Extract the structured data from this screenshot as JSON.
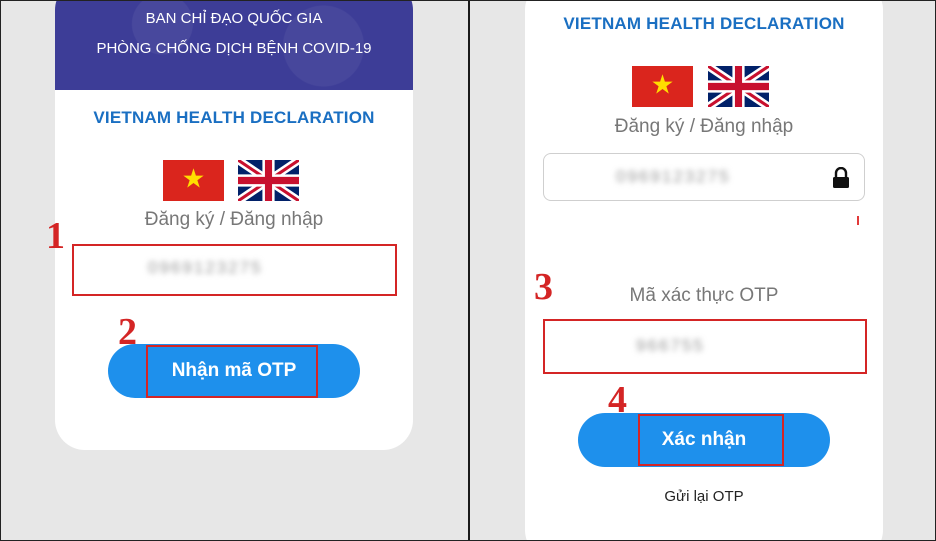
{
  "left_screen": {
    "banner": {
      "line1": "BAN CHỈ ĐẠO QUỐC GIA",
      "line2": "PHÒNG CHỐNG DỊCH BỆNH COVID-19"
    },
    "title": "VIETNAM HEALTH DECLARATION",
    "flags": [
      "vietnam-flag-icon",
      "uk-flag-icon"
    ],
    "login_label": "Đăng ký / Đăng nhập",
    "phone_input_value": "0969123275",
    "get_otp_button": "Nhận mã OTP",
    "step_labels": [
      "1",
      "2"
    ]
  },
  "right_screen": {
    "title": "VIETNAM HEALTH DECLARATION",
    "flags": [
      "vietnam-flag-icon",
      "uk-flag-icon"
    ],
    "login_label": "Đăng ký / Đăng nhập",
    "phone_input_value": "0969123275",
    "lock_icon": "lock-icon",
    "otp_label": "Mã xác thực OTP",
    "otp_input_value": "966755",
    "confirm_button": "Xác nhận",
    "resend_link": "Gửi lại OTP",
    "step_labels": [
      "3",
      "4"
    ]
  },
  "colors": {
    "banner": "#3d3d97",
    "title_blue": "#1a6fc2",
    "button_blue": "#1e90ec",
    "annotation_red": "#d42525",
    "background": "#e7e7e7"
  }
}
